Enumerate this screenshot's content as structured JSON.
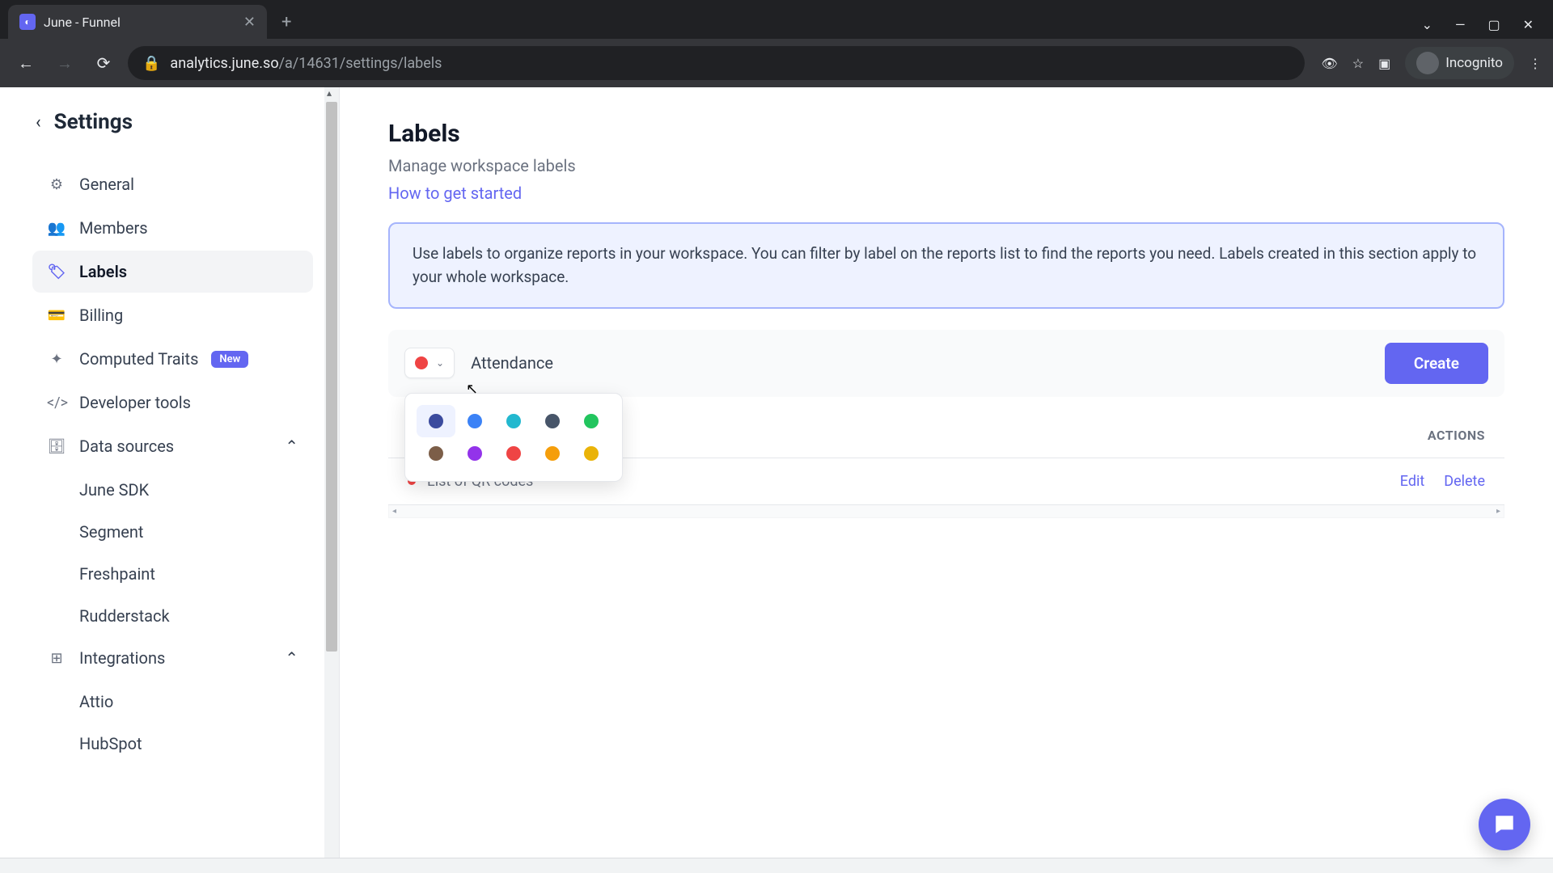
{
  "browser": {
    "tab_title": "June - Funnel",
    "url_domain": "analytics.june.so",
    "url_path": "/a/14631/settings/labels",
    "incognito_label": "Incognito"
  },
  "sidebar": {
    "back_title": "Settings",
    "items": [
      {
        "label": "General"
      },
      {
        "label": "Members"
      },
      {
        "label": "Labels"
      },
      {
        "label": "Billing"
      },
      {
        "label": "Computed Traits",
        "badge": "New"
      },
      {
        "label": "Developer tools"
      },
      {
        "label": "Data sources"
      },
      {
        "label": "Integrations"
      }
    ],
    "data_sources": [
      "June SDK",
      "Segment",
      "Freshpaint",
      "Rudderstack"
    ],
    "integrations": [
      "Attio",
      "HubSpot"
    ]
  },
  "page": {
    "title": "Labels",
    "subtitle": "Manage workspace labels",
    "help_link": "How to get started",
    "info": "Use labels to organize reports in your workspace. You can filter by label on the reports list to find the reports you need. Labels created in this section apply to your whole workspace."
  },
  "create": {
    "selected_color": "#ef4444",
    "input_value": "Attendance",
    "button": "Create"
  },
  "color_options": [
    "#3b4b9e",
    "#3b82f6",
    "#22b8cf",
    "#475569",
    "#22c55e",
    "#7c5e48",
    "#9333ea",
    "#ef4444",
    "#f59e0b",
    "#eab308"
  ],
  "table": {
    "actions_header": "ACTIONS",
    "rows": [
      {
        "color": "#ef4444",
        "name": "List of QR codes",
        "edit": "Edit",
        "delete": "Delete"
      }
    ]
  }
}
